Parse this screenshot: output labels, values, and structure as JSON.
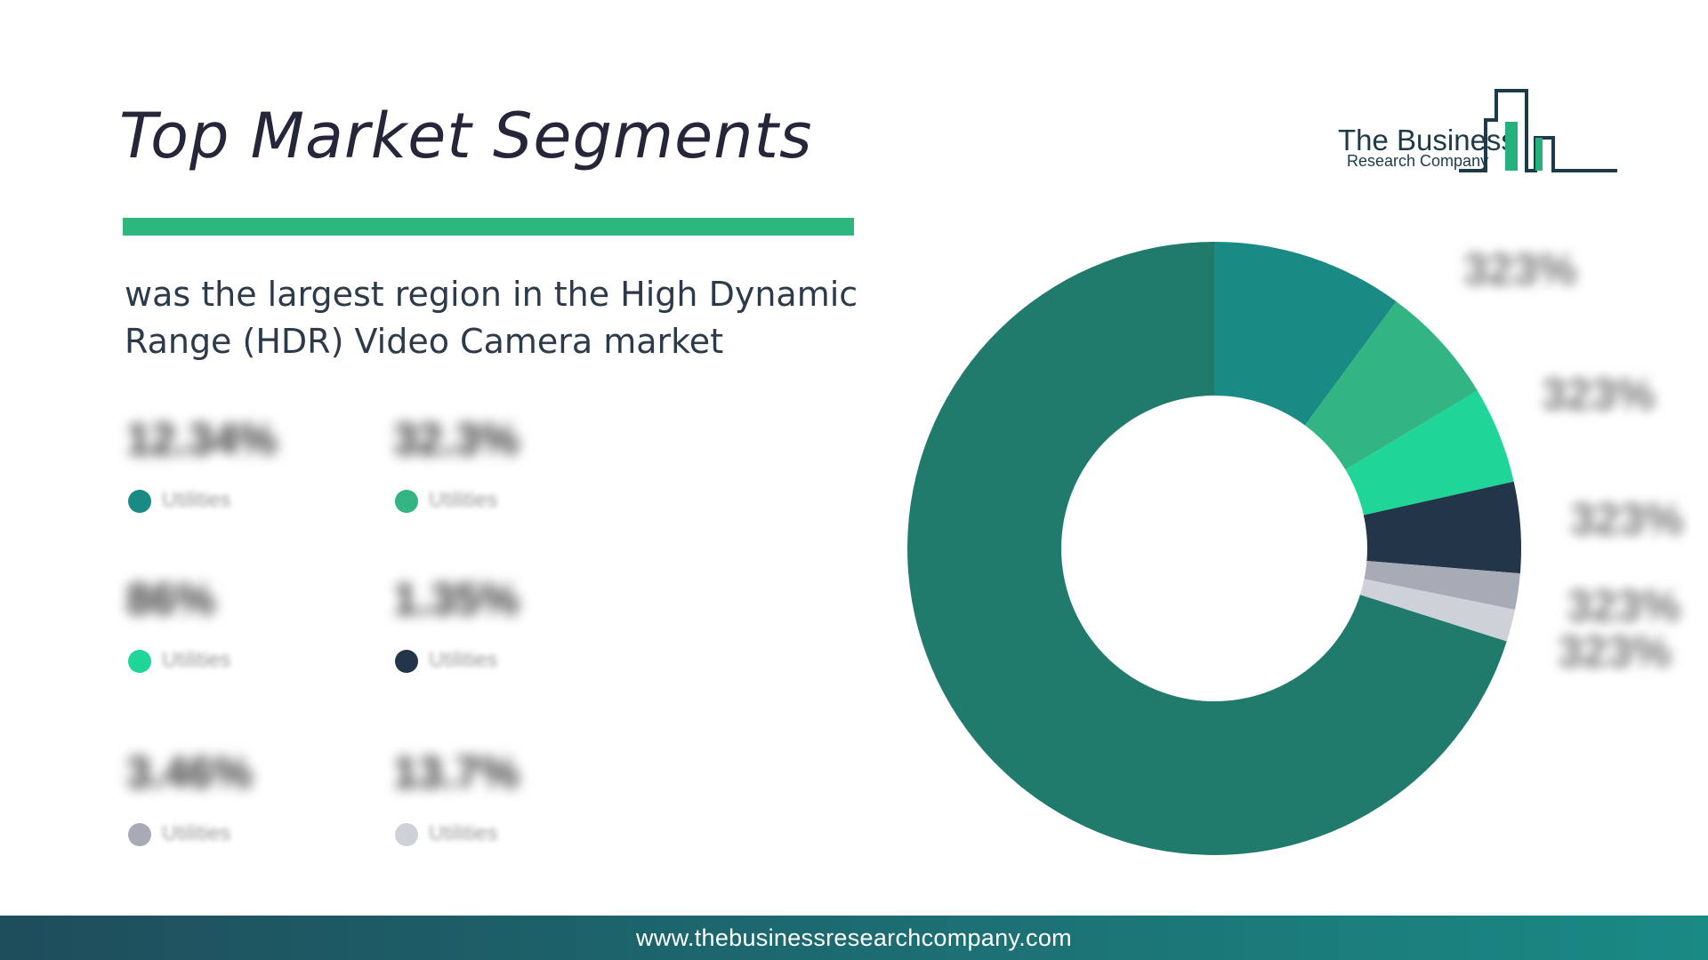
{
  "slide": {
    "title": "Top Market Segments",
    "subtitle": "was the largest region in the High Dynamic Range (HDR) Video Camera market"
  },
  "logo": {
    "line1": "The Business",
    "line2": "Research Company"
  },
  "footer": {
    "url": "www.thebusinessresearchcompany.com"
  },
  "colors": {
    "accent": "#2db77f",
    "footer_start": "#1e4d5c",
    "footer_end": "#1a8a85",
    "logo_dark": "#1d3a48",
    "logo_green": "#26b07e"
  },
  "legend": [
    {
      "value": "12.34%",
      "label": "Utilities",
      "color": "#1a8a85"
    },
    {
      "value": "32.3%",
      "label": "Utilities",
      "color": "#33b583"
    },
    {
      "value": "86%",
      "label": "Utilities",
      "color": "#1fd698"
    },
    {
      "value": "1.35%",
      "label": "Utilities",
      "color": "#223549"
    },
    {
      "value": "3.46%",
      "label": "Utilities",
      "color": "#a6abb5"
    },
    {
      "value": "13.7%",
      "label": "Utilities",
      "color": "#cfd1d9"
    }
  ],
  "chart_data": {
    "type": "pie",
    "donut": true,
    "categories": [
      "Utilities",
      "Utilities",
      "Utilities",
      "Utilities",
      "Utilities",
      "Utilities",
      ""
    ],
    "values": [
      10.1,
      6.3,
      5.1,
      4.8,
      1.9,
      1.7,
      70.1
    ],
    "colors": [
      "#1a8a85",
      "#33b583",
      "#1fd698",
      "#223549",
      "#a6abb5",
      "#cfd1d9",
      "#217b6c"
    ],
    "labels": [
      "323%",
      "323%",
      "323%",
      "323%",
      "323%",
      "323%",
      ""
    ]
  }
}
